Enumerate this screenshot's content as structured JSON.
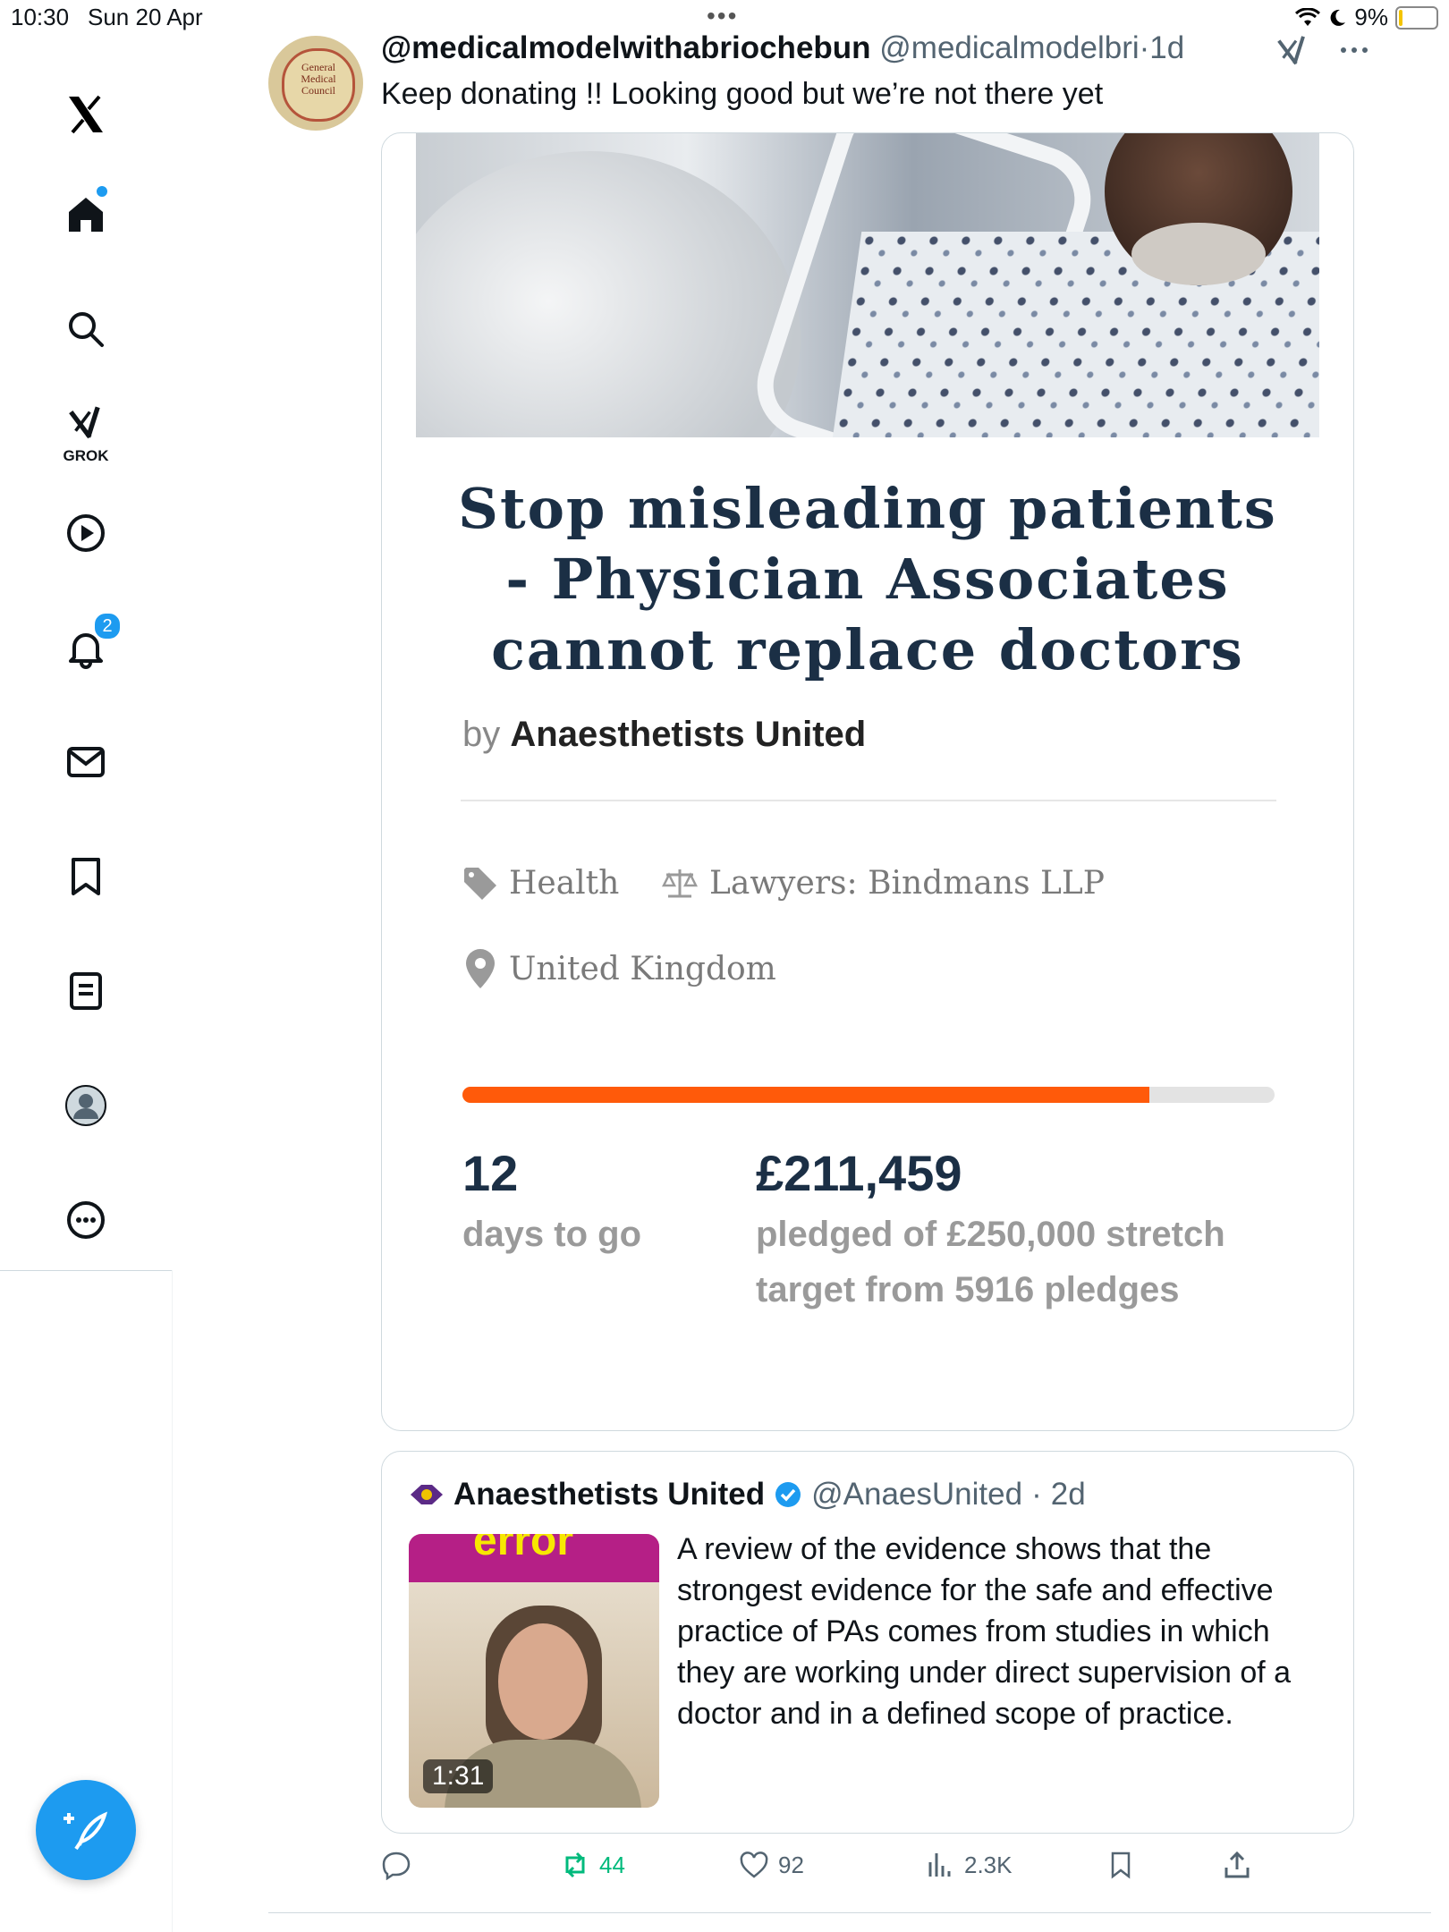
{
  "status_bar": {
    "time": "10:30",
    "date": "Sun 20 Apr",
    "battery": "9%",
    "battery_level_percent": 9
  },
  "sidebar": {
    "items": [
      {
        "name": "x-logo",
        "icon": "x-logo-icon"
      },
      {
        "name": "home",
        "icon": "home-icon",
        "has_dot": true
      },
      {
        "name": "explore",
        "icon": "search-icon"
      },
      {
        "name": "grok",
        "icon": "grok-icon",
        "label": "GROK"
      },
      {
        "name": "video",
        "icon": "play-icon"
      },
      {
        "name": "notifications",
        "icon": "bell-icon",
        "badge": "2"
      },
      {
        "name": "messages",
        "icon": "envelope-icon"
      },
      {
        "name": "bookmarks",
        "icon": "bookmark-icon"
      },
      {
        "name": "lists",
        "icon": "list-icon"
      },
      {
        "name": "profile",
        "icon": "profile-icon"
      },
      {
        "name": "more",
        "icon": "more-icon"
      }
    ],
    "compose_icon": "compose-feather-icon"
  },
  "tweet": {
    "author_name": "@medicalmodelwithabriochebun",
    "author_handle": "@medicalmodelbri",
    "separator": "·",
    "age": "1d",
    "text": "Keep donating !! Looking good but we’re not there yet",
    "avatar_text": "General Medical Council",
    "card": {
      "title": "Stop misleading patients - Physician Associates cannot replace doctors",
      "by_prefix": "by",
      "by_name": "Anaesthetists United",
      "category": "Health",
      "lawyers": "Lawyers: Bindmans LLP",
      "location": "United Kingdom",
      "progress_fraction": 0.846,
      "days_number": "12",
      "days_label": "days to go",
      "amount": "£211,459",
      "amount_label": "pledged of £250,000 stretch target from 5916 pledges"
    },
    "quote": {
      "author_name": "Anaesthetists United",
      "author_handle": "@AnaesUnited",
      "separator": "·",
      "age": "2d",
      "thumb_word": "error",
      "video_duration": "1:31",
      "text": "A review of the evidence shows that the strongest evidence for the safe and effective practice of PAs comes from studies in which they are working under direct supervision of a doctor and in a defined scope of practice."
    },
    "actions": {
      "reply_count": "",
      "retweet_count": "44",
      "like_count": "92",
      "views_count": "2.3K"
    }
  },
  "colors": {
    "accent": "#1d9bf0",
    "progress": "#ff5a0a",
    "retweet": "#00ba7c",
    "title_navy": "#1b2f45"
  }
}
